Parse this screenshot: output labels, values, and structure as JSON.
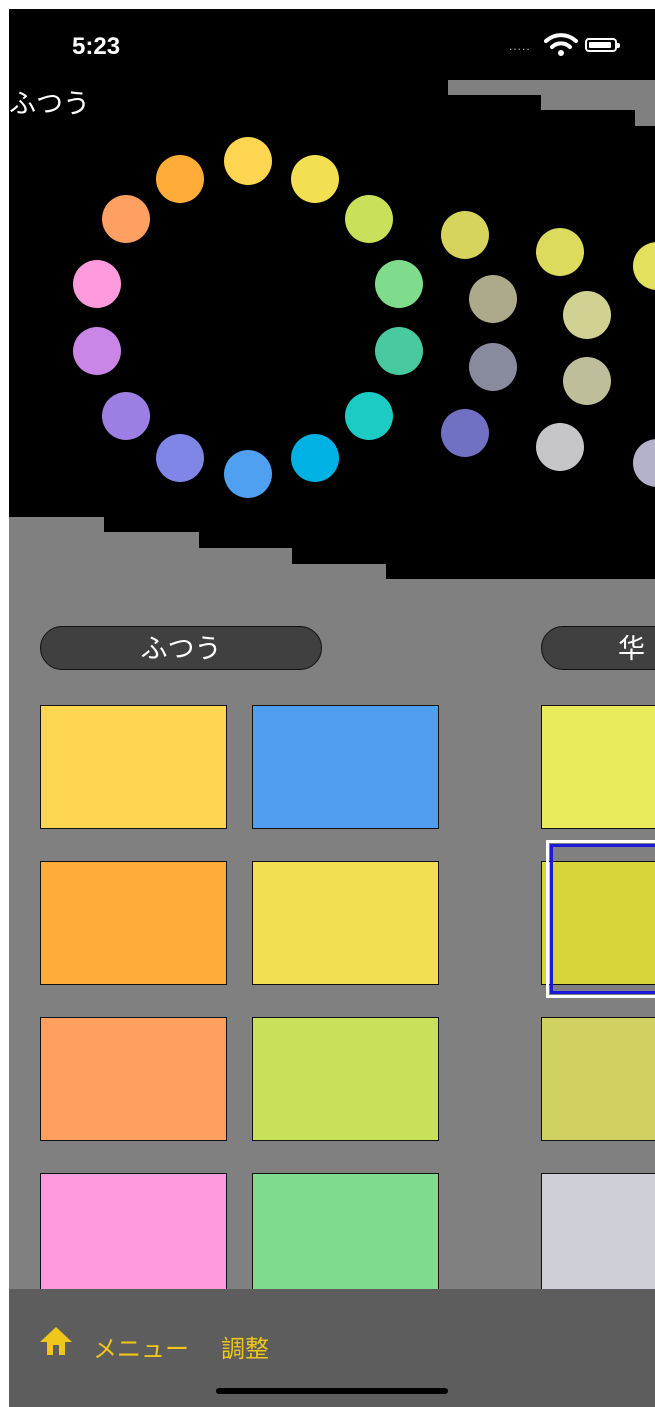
{
  "status_bar": {
    "time": "5:23",
    "signal": "....."
  },
  "screen": {
    "title": "ふつう"
  },
  "wheels": [
    {
      "name": "normal-wheel",
      "colors": [
        "#ffd651",
        "#f2e052",
        "#c9e15a",
        "#7fdc8d",
        "#49c9a0",
        "#1ccbc4",
        "#00b1e3",
        "#4fa0f0",
        "#7f86e6",
        "#9b7fe2",
        "#c986e6",
        "#ff9bdc",
        "#ff9f61",
        "#ffad38"
      ]
    },
    {
      "name": "second-wheel",
      "colors": [
        "#d6d45c",
        "#acaa8a",
        "#888a9e",
        "#7171c4"
      ]
    },
    {
      "name": "third-wheel",
      "colors": [
        "#dddb5e",
        "#d1d193",
        "#bebe9a",
        "#c6c6c9"
      ]
    },
    {
      "name": "fourth-wheel",
      "colors": [
        "#e2e05c",
        "#b4b2cb"
      ]
    }
  ],
  "sections": {
    "normal": {
      "label": "ふつう"
    },
    "second": {
      "label": "华"
    }
  },
  "palette_left": [
    [
      "#ffd651",
      "#509ef0"
    ],
    [
      "#ffad38",
      "#f2e052"
    ],
    [
      "#ffa061",
      "#c9e15a"
    ],
    [
      "#ff9adc",
      "#7fdb8d"
    ]
  ],
  "palette_right": [
    "#e9eb5c",
    "#d8d538",
    "#d1d162",
    "#cfcfd8"
  ],
  "toolbar": {
    "home_icon": "home-icon",
    "menu_label": "メニュー",
    "adjust_label": "調整"
  }
}
